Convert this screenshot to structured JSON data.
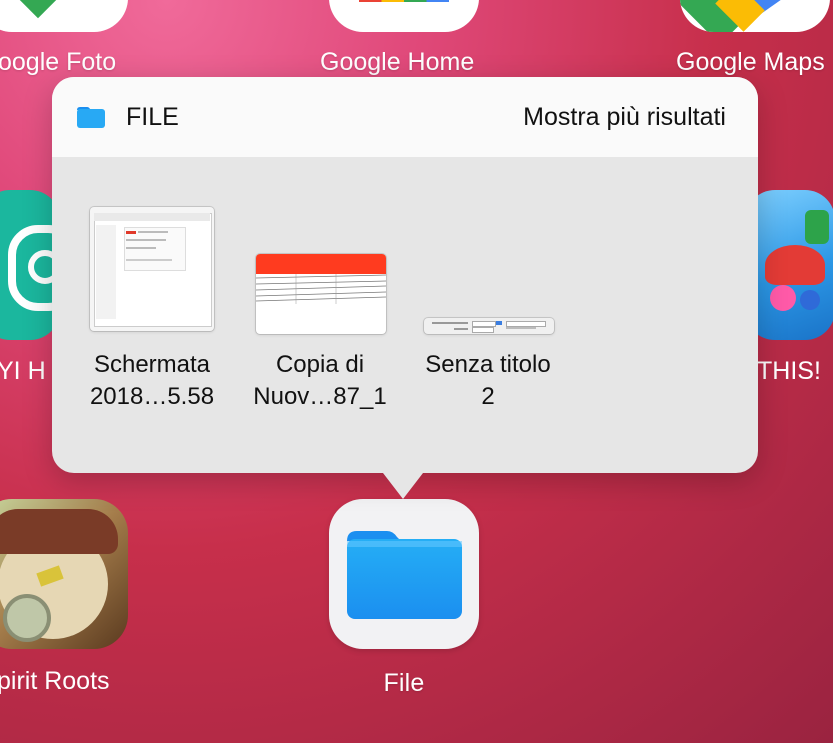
{
  "home_screen": {
    "top_row": [
      {
        "label": "oogle Foto",
        "icon": "google-photos-icon"
      },
      {
        "label": "Google Home",
        "icon": "google-home-icon"
      },
      {
        "label": "Google Maps",
        "icon": "google-maps-icon"
      }
    ],
    "middle_row": [
      {
        "label": "YI H",
        "icon": "yi-home-icon"
      },
      {
        "label": "THIS!",
        "icon": "game-icon"
      }
    ],
    "bottom_row": [
      {
        "label": "pirit Roots",
        "icon": "spirit-roots-icon"
      },
      {
        "label": "File",
        "icon": "files-folder-icon"
      }
    ]
  },
  "popover": {
    "section_title": "FILE",
    "more_results": "Mostra più risultati",
    "files": [
      {
        "line1": "Schermata",
        "line2": "2018…5.58"
      },
      {
        "line1": "Copia di",
        "line2": "Nuov…87_1"
      },
      {
        "line1": "Senza titolo",
        "line2": "2"
      }
    ]
  },
  "colors": {
    "wallpaper_pink": "#e0497a",
    "wallpaper_red": "#c72f4b",
    "folder_blue": "#1b8ff0",
    "popover_bg": "#e6e6e6",
    "header_bg": "#fafafa"
  }
}
